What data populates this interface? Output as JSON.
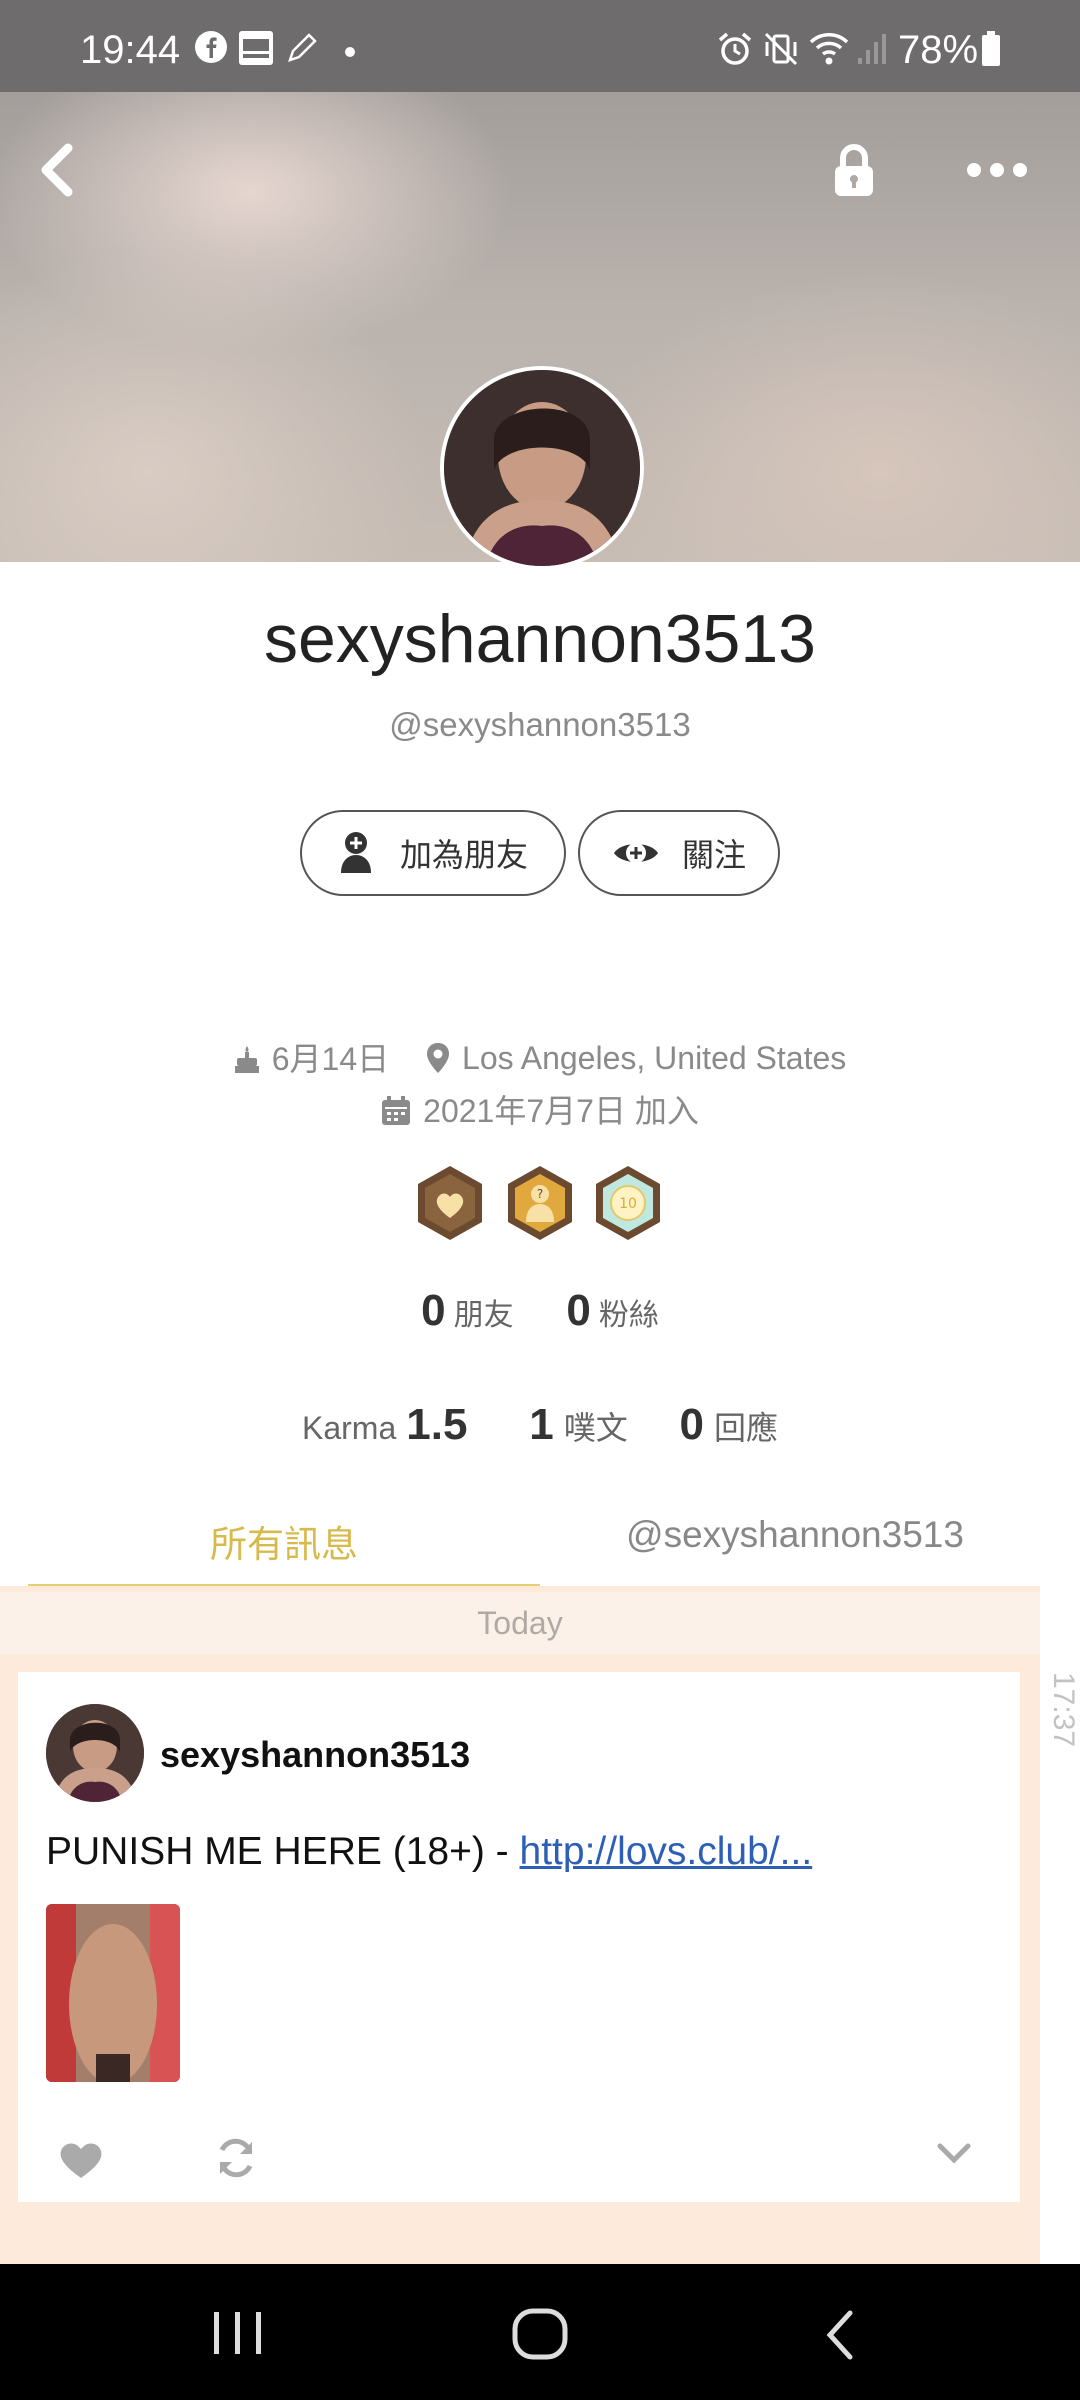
{
  "status_bar": {
    "time": "19:44",
    "battery": "78%"
  },
  "profile": {
    "display_name": "sexyshannon3513",
    "handle": "@sexyshannon3513",
    "add_friend_label": "加為朋友",
    "follow_label": "關注",
    "birthday": "6月14日",
    "location": "Los Angeles, United States",
    "joined": "2021年7月7日 加入",
    "friends_count": "0",
    "friends_label": "朋友",
    "fans_count": "0",
    "fans_label": "粉絲",
    "karma_label": "Karma",
    "karma_value": "1.5",
    "plurks_count": "1",
    "plurks_label": "噗文",
    "responses_count": "0",
    "responses_label": "回應"
  },
  "tabs": [
    {
      "label": "所有訊息"
    },
    {
      "label": "@sexyshannon3513"
    }
  ],
  "feed": {
    "day_label": "Today",
    "side_time": "17:37",
    "post": {
      "user": "sexyshannon3513",
      "text": "PUNISH ME HERE (18+) - ",
      "link_text": "http://lovs.club/..."
    }
  },
  "colors": {
    "accent": "#e5cf73",
    "tab_active": "#d8b94c",
    "feed_bg": "#fdeadb",
    "link": "#2d5fb7"
  }
}
